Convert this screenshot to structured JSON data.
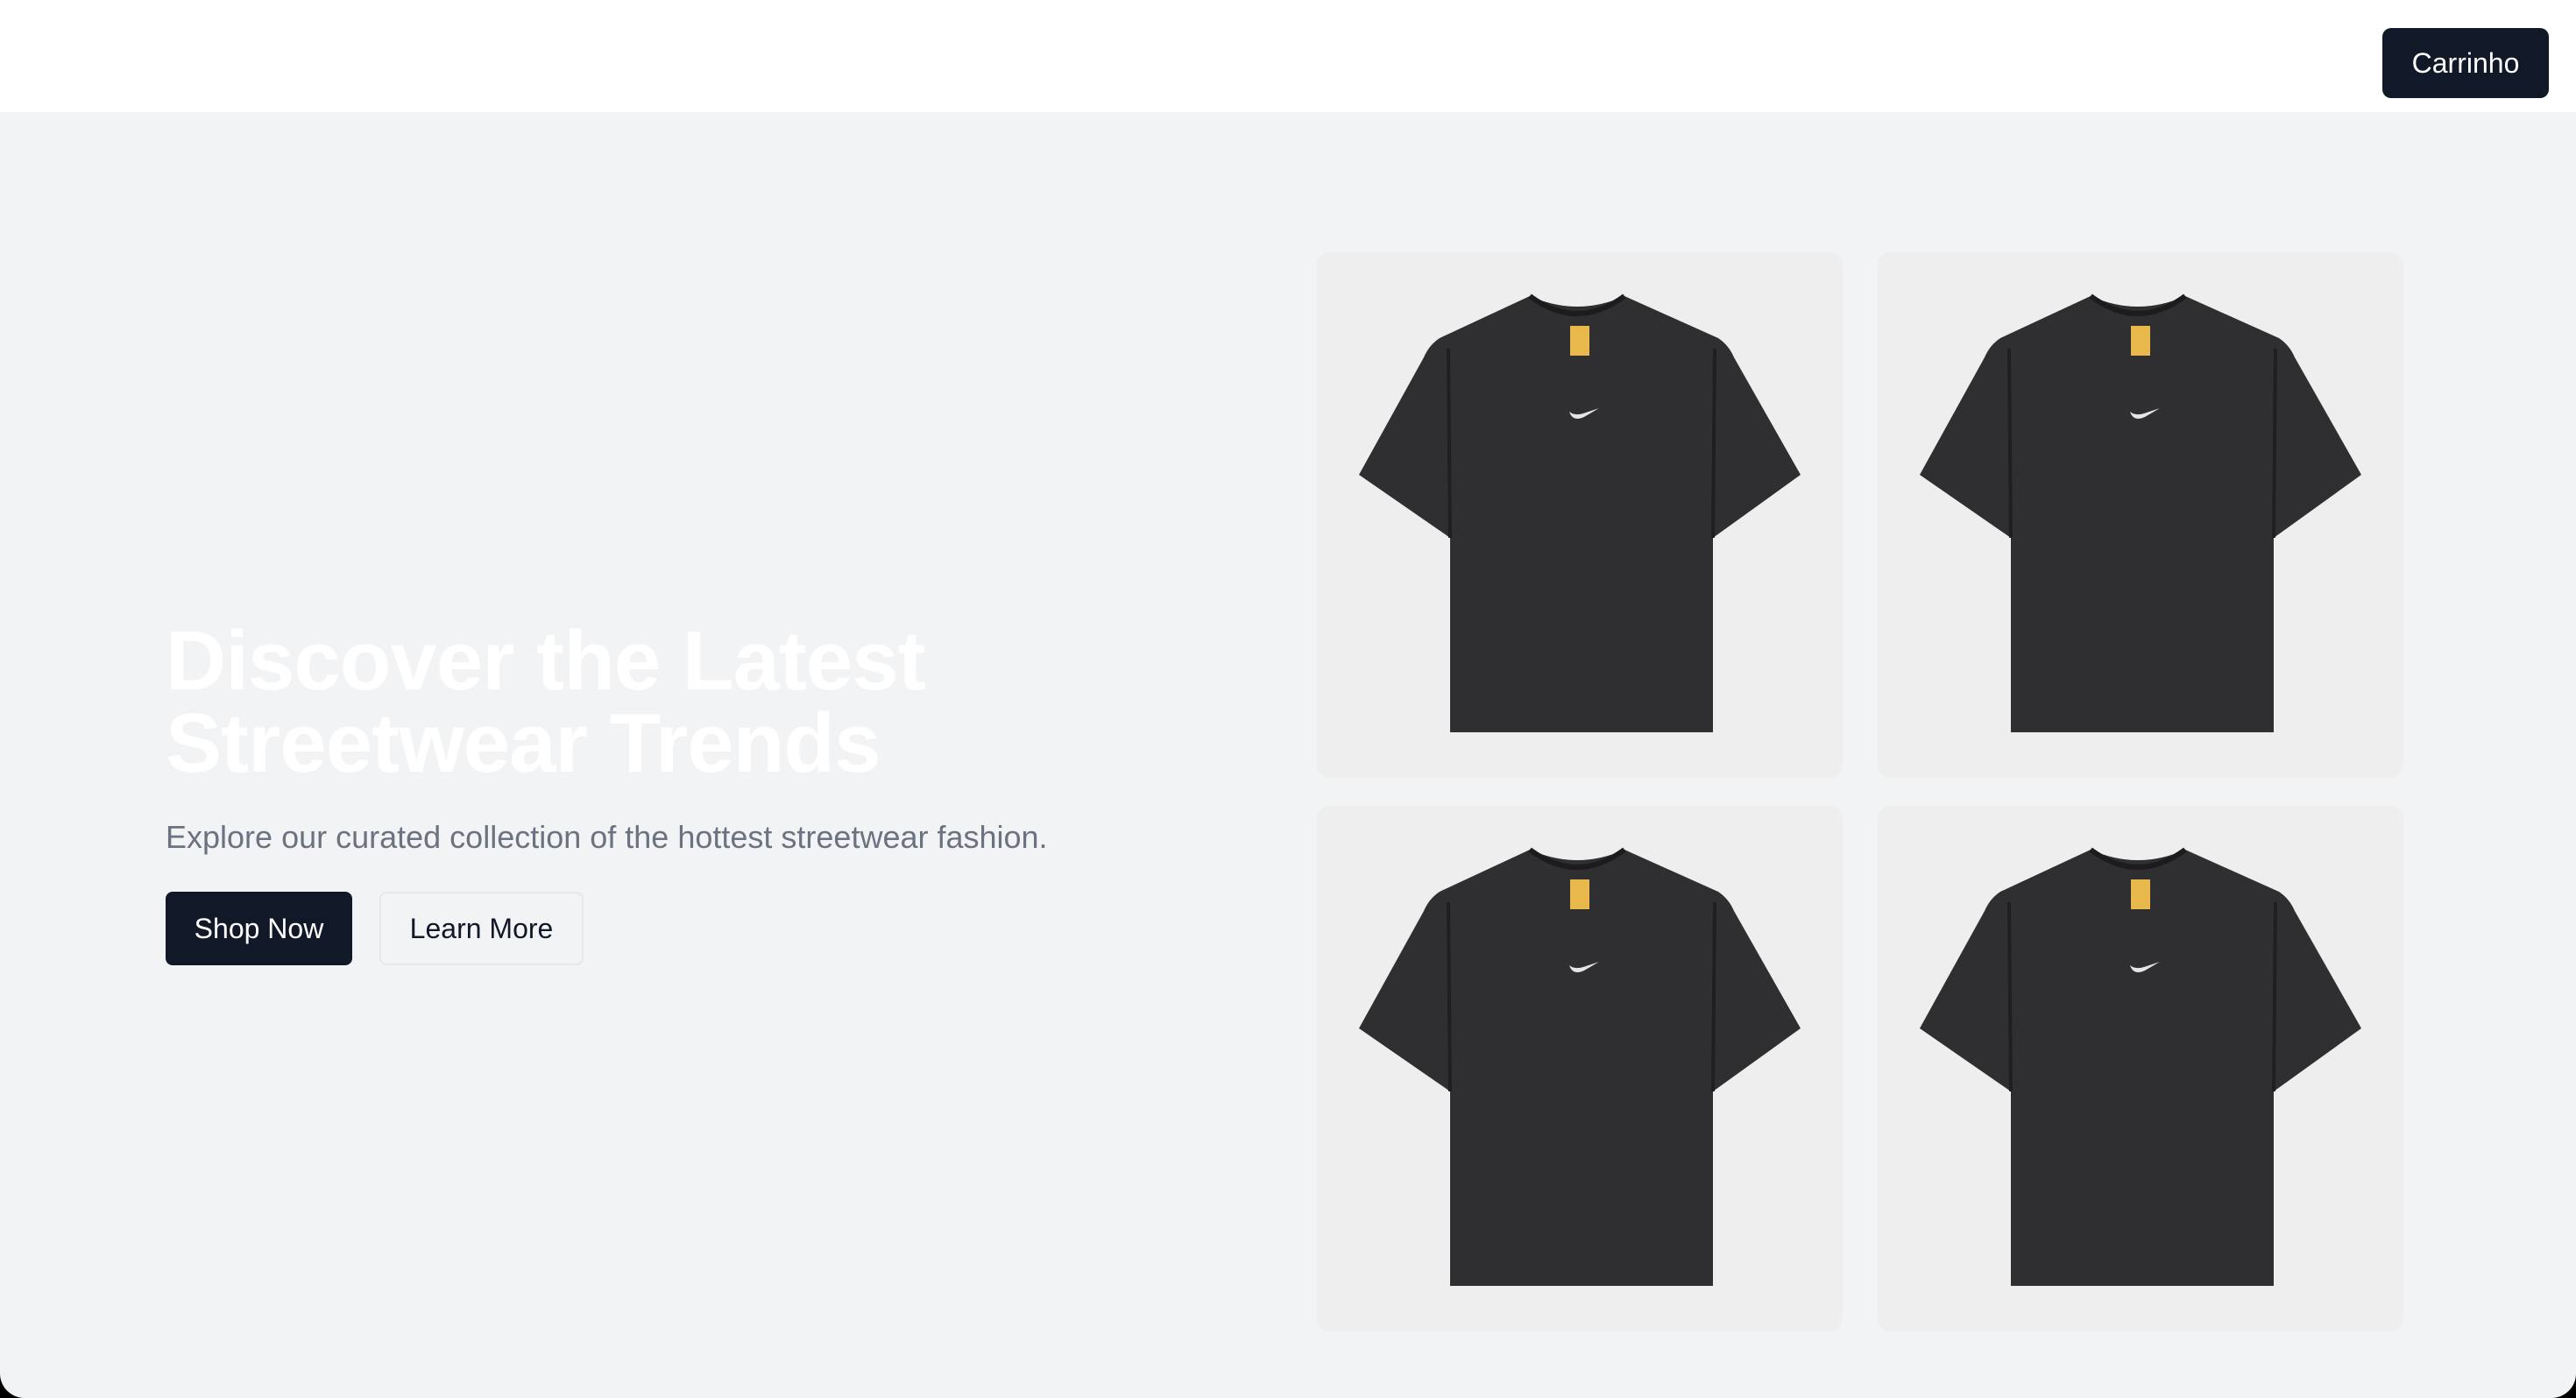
{
  "header": {
    "cart_label": "Carrinho"
  },
  "hero": {
    "title": "Discover the Latest Streetwear Trends",
    "subtitle": "Explore our curated collection of the hottest streetwear fashion.",
    "primary_cta": "Shop Now",
    "secondary_cta": "Learn More"
  },
  "products": [
    {
      "image": "black-tshirt"
    },
    {
      "image": "black-tshirt"
    },
    {
      "image": "black-tshirt"
    },
    {
      "image": "black-tshirt"
    }
  ],
  "colors": {
    "primary": "#111827",
    "background": "#f2f3f5",
    "muted_text": "#6b7280",
    "shirt": "#2f2f31",
    "label_tag": "#e8b84a"
  }
}
